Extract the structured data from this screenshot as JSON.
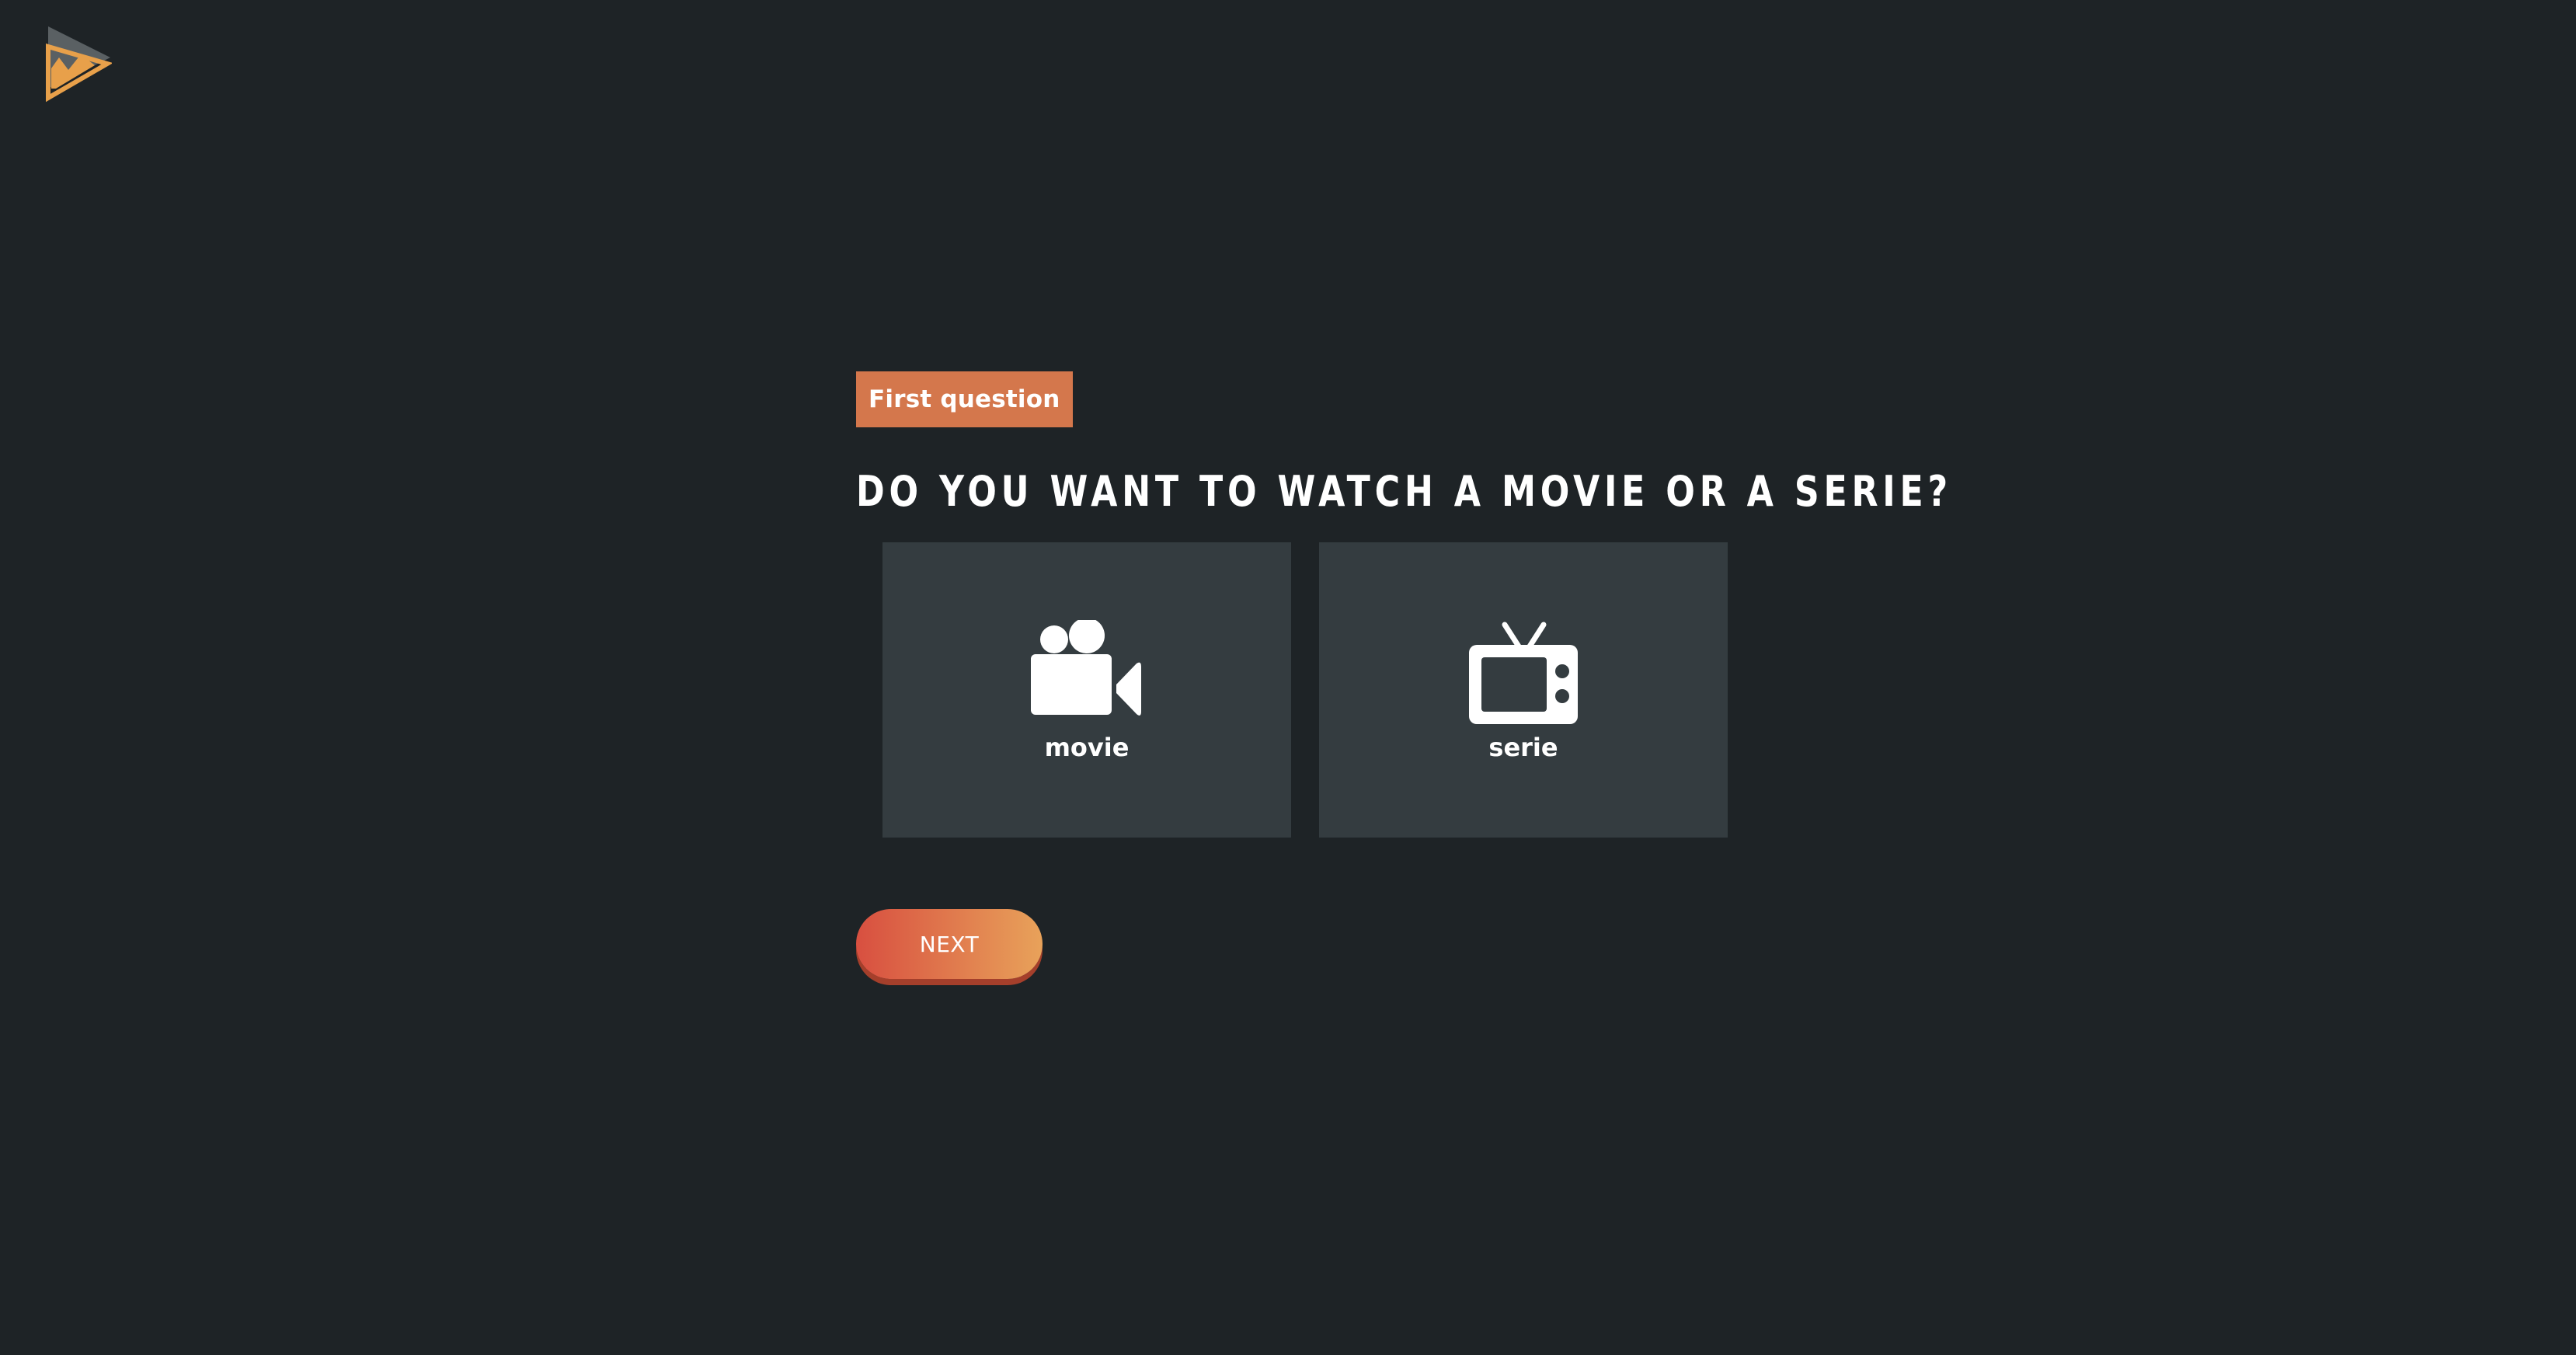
{
  "brand": {
    "logo_icon": "play-logo-icon",
    "accent_color": "#e8a04a",
    "secondary_color": "#5a6063"
  },
  "question": {
    "badge": "First question",
    "title": "DO YOU WANT TO WATCH A MOVIE OR A SERIE?"
  },
  "options": [
    {
      "id": "movie",
      "label": "movie",
      "icon": "movie-camera-icon"
    },
    {
      "id": "serie",
      "label": "serie",
      "icon": "tv-icon"
    }
  ],
  "actions": {
    "next_label": "NEXT"
  },
  "colors": {
    "background": "#1e2326",
    "card": "#343c40",
    "badge": "#d4774c",
    "button_start": "#d84f40",
    "button_end": "#e8a25a"
  }
}
